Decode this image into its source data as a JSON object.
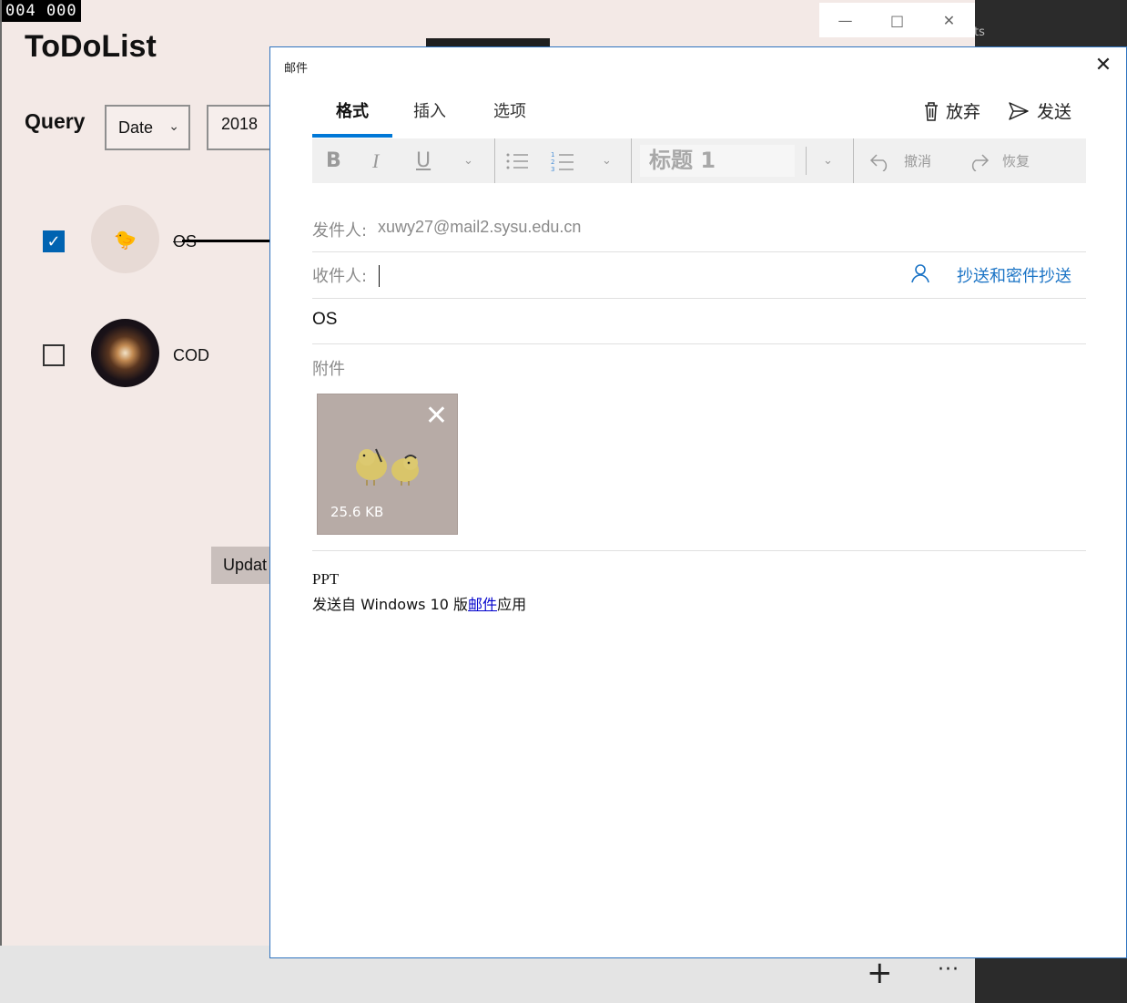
{
  "overlay": {
    "counter_text": "004   000"
  },
  "todo_app": {
    "title": "ToDoList",
    "query": {
      "label": "Query",
      "sort_value": "Date",
      "year_value": "2018"
    },
    "items": [
      {
        "label": "OS",
        "checked": true
      },
      {
        "label": "COD",
        "checked": false
      }
    ],
    "update_button": "Updat",
    "background_text": "ts"
  },
  "mail": {
    "window_title": "邮件",
    "tabs": [
      "格式",
      "插入",
      "选项"
    ],
    "active_tab": "格式",
    "actions": {
      "discard": "放弃",
      "send": "发送"
    },
    "toolbar": {
      "bold": "B",
      "italic": "I",
      "underline": "U",
      "heading_style": "标题 1",
      "undo": "撤消",
      "redo": "恢复"
    },
    "from": {
      "label": "发件人:",
      "value": "xuwy27@mail2.sysu.edu.cn"
    },
    "to": {
      "label": "收件人:",
      "value": ""
    },
    "cc_bcc_link": "抄送和密件抄送",
    "subject": "OS",
    "attachments_label": "附件",
    "attachment": {
      "size": "25.6 KB"
    },
    "body": {
      "line1": "PPT",
      "line2_prefix": "发送自 Windows 10 版",
      "line2_link": "邮件",
      "line2_suffix": "应用"
    },
    "colors": {
      "accent": "#0078d7",
      "link": "#1a73c5"
    }
  }
}
